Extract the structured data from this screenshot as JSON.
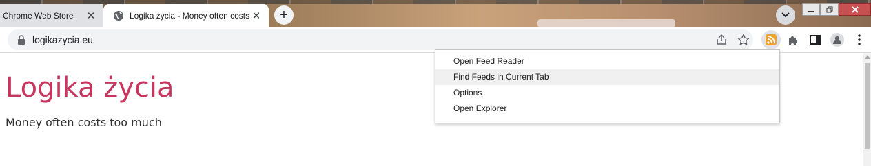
{
  "browser": {
    "tabs": [
      {
        "label": "Chrome Web Store",
        "active": false
      },
      {
        "label": "Logika życia - Money often costs",
        "active": true
      }
    ],
    "new_tab": "+",
    "close_glyph": "✕",
    "address": "logikazycia.eu"
  },
  "page": {
    "title": "Logika życia",
    "tagline": "Money often costs too much"
  },
  "context_menu": {
    "items": [
      {
        "label": "Open Feed Reader"
      },
      {
        "label": "Find Feeds in Current Tab",
        "highlighted": true
      },
      {
        "label": "Options"
      },
      {
        "label": "Open Explorer"
      }
    ]
  },
  "colors": {
    "site_title": "#c7365f",
    "rss_icon": "#f0a030"
  }
}
